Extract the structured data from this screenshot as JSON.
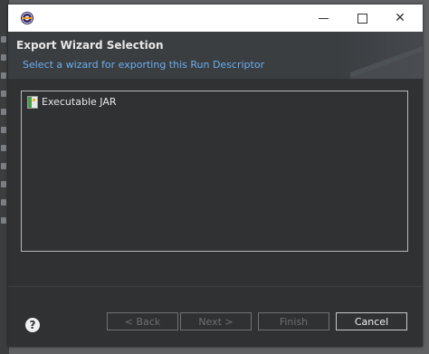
{
  "dialog": {
    "header": {
      "title": "Export Wizard Selection",
      "subtitle": "Select a wizard for exporting this Run Descriptor"
    },
    "tree": {
      "items": [
        {
          "label": "Executable JAR",
          "icon": "jar-icon"
        }
      ]
    },
    "footer": {
      "help_label": "?",
      "back_label": "< Back",
      "next_label": "Next >",
      "finish_label": "Finish",
      "cancel_label": "Cancel"
    }
  },
  "colors": {
    "header_subtitle": "#6aaef0",
    "dialog_bg": "#2f3133"
  }
}
